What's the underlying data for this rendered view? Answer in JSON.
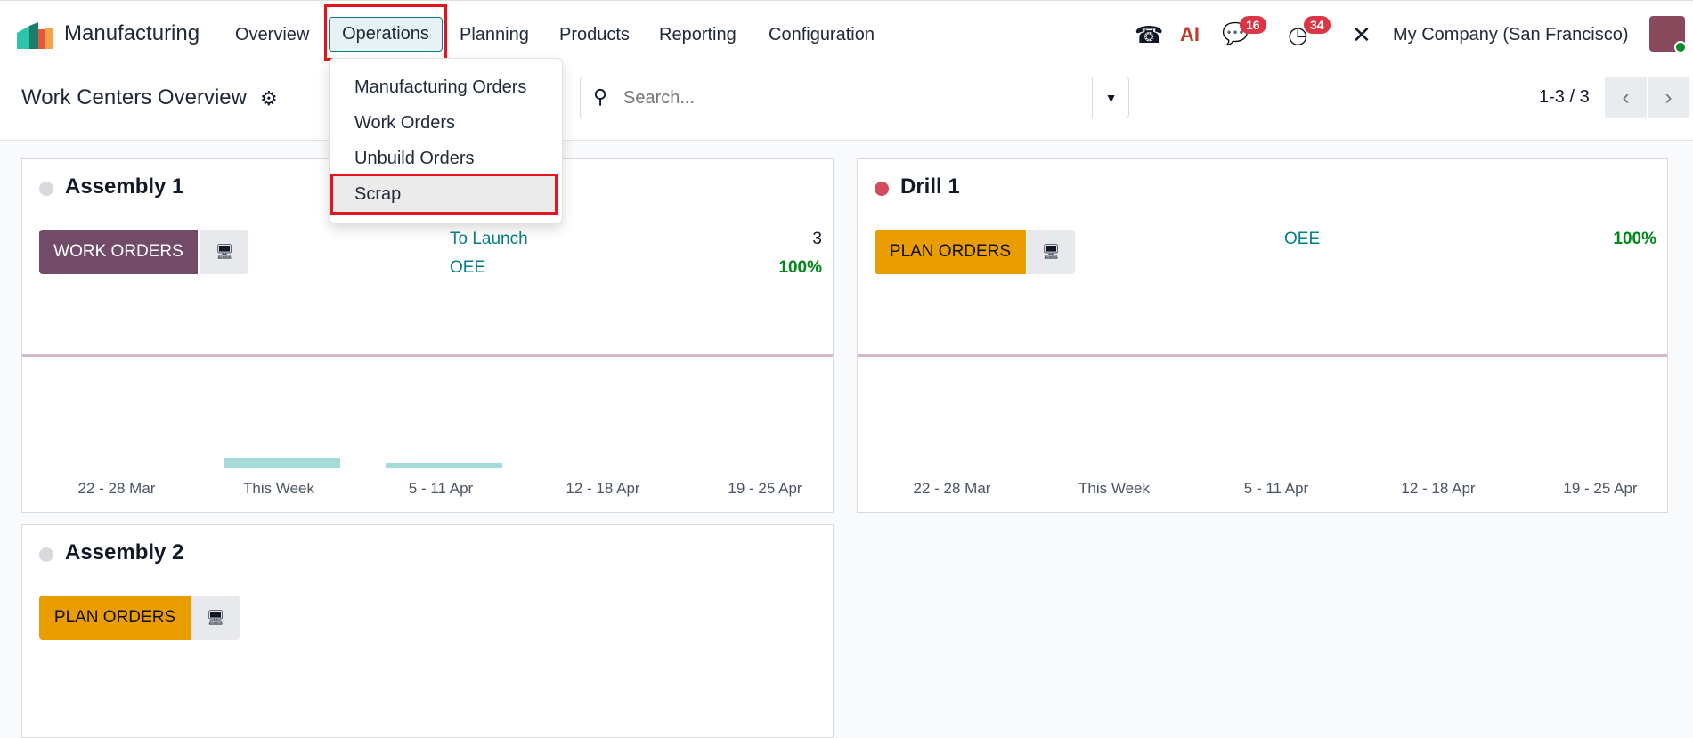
{
  "navbar": {
    "app": "Manufacturing",
    "menu": [
      "Overview",
      "Operations",
      "Planning",
      "Products",
      "Reporting",
      "Configuration"
    ],
    "company": "My Company (San Francisco)",
    "messages_badge": "16",
    "activities_badge": "34",
    "ai_label": "AI"
  },
  "dropdown": {
    "items": [
      "Manufacturing Orders",
      "Work Orders",
      "Unbuild Orders",
      "Scrap"
    ]
  },
  "control": {
    "title": "Work Centers Overview",
    "search_placeholder": "Search...",
    "pager": "1-3 / 3"
  },
  "cards": [
    {
      "name": "Assembly 1",
      "status_color": "#d8d9dc",
      "button": "WORK ORDERS",
      "button_color": "#714b67",
      "stats": [
        {
          "label": "To Launch",
          "value": "3"
        },
        {
          "label": "OEE",
          "value": "100%"
        }
      ]
    },
    {
      "name": "Drill 1",
      "status_color": "#d44c59",
      "button": "PLAN ORDERS",
      "button_color": "#e99d00",
      "stats": [
        {
          "label": "OEE",
          "value": "100%"
        }
      ]
    },
    {
      "name": "Assembly 2",
      "status_color": "#d8d9dc",
      "button": "PLAN ORDERS",
      "button_color": "#e99d00"
    }
  ],
  "chart_data": [
    {
      "type": "bar",
      "title": "Assembly 1 workload",
      "categories": [
        "22 - 28 Mar",
        "This Week",
        "5 - 11 Apr",
        "12 - 18 Apr",
        "19 - 25 Apr"
      ],
      "values": [
        0,
        2,
        1,
        0,
        0
      ]
    },
    {
      "type": "bar",
      "title": "Drill 1 workload",
      "categories": [
        "22 - 28 Mar",
        "This Week",
        "5 - 11 Apr",
        "12 - 18 Apr",
        "19 - 25 Apr"
      ],
      "values": [
        0,
        0,
        0,
        0,
        0
      ]
    }
  ]
}
